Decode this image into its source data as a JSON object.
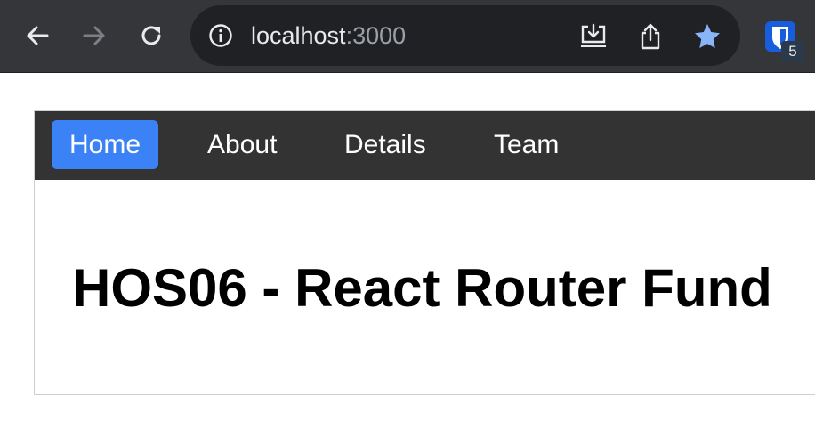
{
  "browser": {
    "address_host": "localhost",
    "address_port": ":3000",
    "extension_badge": "5",
    "icons": [
      "back-icon",
      "forward-icon",
      "reload-icon",
      "info-icon",
      "install-icon",
      "share-icon",
      "bookmark-star-icon",
      "extension-icon"
    ],
    "bookmark_star_color": "#8ab4f8"
  },
  "app": {
    "nav": [
      {
        "label": "Home",
        "active": true
      },
      {
        "label": "About",
        "active": false
      },
      {
        "label": "Details",
        "active": false
      },
      {
        "label": "Team",
        "active": false
      }
    ],
    "active_color": "#3b82f6",
    "nav_background": "#333333",
    "heading": "HOS06 - React Router Fund"
  }
}
